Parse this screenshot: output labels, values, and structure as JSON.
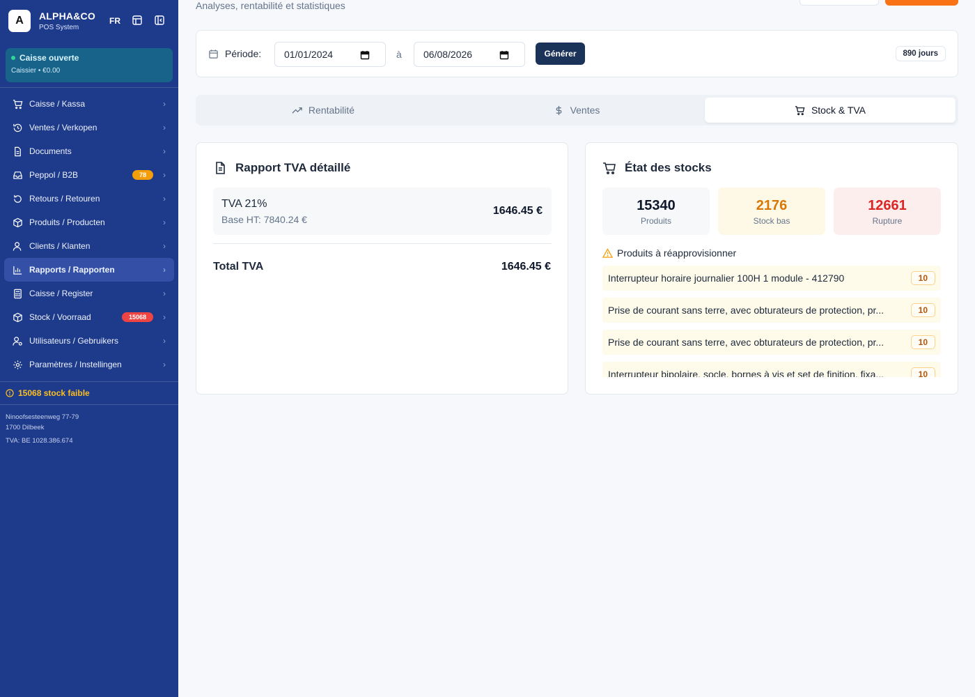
{
  "sidebar": {
    "brand_initial": "A",
    "brand_name": "ALPHA&CO",
    "brand_sub": "POS System",
    "lang": "FR",
    "caisse_status": "Caisse ouverte",
    "caisse_sub": "Caissier • €0.00",
    "items": [
      {
        "label": "Caisse / Kassa",
        "icon": "cart-icon"
      },
      {
        "label": "Ventes / Verkopen",
        "icon": "history-icon"
      },
      {
        "label": "Documents",
        "icon": "document-icon"
      },
      {
        "label": "Peppol / B2B",
        "icon": "inbox-icon",
        "badge": "78"
      },
      {
        "label": "Retours / Retouren",
        "icon": "return-icon"
      },
      {
        "label": "Produits / Producten",
        "icon": "package-icon"
      },
      {
        "label": "Clients / Klanten",
        "icon": "users-icon"
      },
      {
        "label": "Rapports / Rapporten",
        "icon": "chart-icon",
        "active": true
      },
      {
        "label": "Caisse / Register",
        "icon": "calculator-icon"
      },
      {
        "label": "Stock / Voorraad",
        "icon": "box-icon",
        "badge": "15068"
      },
      {
        "label": "Utilisateurs / Gebruikers",
        "icon": "user-cog-icon"
      },
      {
        "label": "Paramètres / Instellingen",
        "icon": "gear-icon"
      }
    ],
    "low_stock": "15068 stock faible",
    "address_line1": "Ninoofsesteenweg 77-79",
    "address_line2": "1700 Dilbeek",
    "vat": "TVA: BE 1028.386.674"
  },
  "header": {
    "subtitle": "Analyses, rentabilité et statistiques"
  },
  "period": {
    "label": "Période:",
    "from": "01/01/2024",
    "separator": "à",
    "to": "06/08/2026",
    "generate": "Générer",
    "days": "890 jours"
  },
  "tabs": [
    {
      "label": "Rentabilité",
      "icon": "trending-up-icon"
    },
    {
      "label": "Ventes",
      "icon": "dollar-icon"
    },
    {
      "label": "Stock & TVA",
      "icon": "cart-icon",
      "active": true
    }
  ],
  "tva": {
    "title": "Rapport TVA détaillé",
    "rate": "TVA 21%",
    "base": "Base HT: 7840.24 €",
    "amount": "1646.45 €",
    "total_label": "Total TVA",
    "total_value": "1646.45 €"
  },
  "stock": {
    "title": "État des stocks",
    "stats": [
      {
        "value": "15340",
        "label": "Produits",
        "color": "#0f172a",
        "bg": "#f6f8fa"
      },
      {
        "value": "2176",
        "label": "Stock bas",
        "color": "#d97706",
        "bg": "#fef9e7"
      },
      {
        "value": "12661",
        "label": "Rupture",
        "color": "#dc2626",
        "bg": "#fdeeee"
      }
    ],
    "restock_title": "Produits à réapprovisionner",
    "restock": [
      {
        "name": "Interrupteur horaire journalier 100H 1 module - 412790",
        "qty": "10"
      },
      {
        "name": "Prise de courant sans terre, avec obturateurs de protection, pr...",
        "qty": "10"
      },
      {
        "name": "Prise de courant sans terre, avec obturateurs de protection, pr...",
        "qty": "10"
      },
      {
        "name": "Interrupteur bipolaire, socle, bornes à vis et set de finition, fixa...",
        "qty": "10"
      }
    ]
  }
}
